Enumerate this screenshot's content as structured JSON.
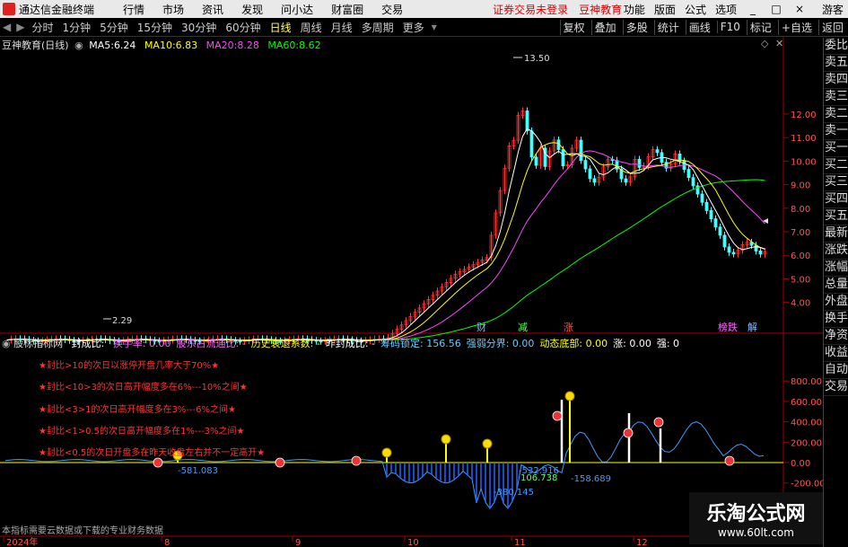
{
  "menubar": {
    "app_title": "通达信金融终端",
    "menus": [
      "行情",
      "市场",
      "资讯",
      "发现",
      "问小达",
      "财富圈",
      "交易"
    ],
    "notice": "证券交易未登录",
    "brand": "豆神教育",
    "right_items": [
      "功能",
      "版面",
      "公式",
      "选项"
    ],
    "guest": "游客",
    "window_buttons": [
      "_",
      "□",
      "×"
    ]
  },
  "period_bar": {
    "periods": [
      "分时",
      "1分钟",
      "5分钟",
      "15分钟",
      "30分钟",
      "60分钟",
      "日线",
      "周线",
      "月线",
      "多周期",
      "更多"
    ],
    "active": "日线",
    "tools": [
      "复权",
      "叠加",
      "多股",
      "统计",
      "画线",
      "F10",
      "标记",
      "+自选",
      "返回"
    ]
  },
  "main_chart": {
    "title": "豆神教育(日线)",
    "ma": [
      {
        "label": "MA5:",
        "value": "6.24",
        "color": "#ffffff"
      },
      {
        "label": "MA10:",
        "value": "6.83",
        "color": "#ffff00"
      },
      {
        "label": "MA20:",
        "value": "8.28",
        "color": "#ff44ff"
      },
      {
        "label": "MA60:",
        "value": "8.62",
        "color": "#00ff00"
      }
    ],
    "y_ticks": [
      "12.00",
      "11.00",
      "10.00",
      "9.00",
      "8.00",
      "7.00",
      "6.00",
      "5.00",
      "4.00"
    ],
    "high_label": "13.50",
    "low_label": "2.29",
    "markers": [
      {
        "text": "财",
        "color": "#88bbff"
      },
      {
        "text": "减",
        "color": "#66ff66"
      },
      {
        "text": "涨",
        "color": "#ff5555"
      },
      {
        "text": "榜跌",
        "color": "#ff66ff"
      },
      {
        "text": "解",
        "color": "#88bbff"
      }
    ]
  },
  "indicator": {
    "name": "股标指标网",
    "items": [
      {
        "label": "封成比:",
        "value": "",
        "color": "#ffffff"
      },
      {
        "label": "换手率:",
        "value": "0.00",
        "color": "#ff66ff"
      },
      {
        "label": "股东占流通比:",
        "value": "-",
        "color": "#ff66ff"
      },
      {
        "label": "历史衰退系数:",
        "value": "-",
        "color": "#ffff00"
      },
      {
        "label": "昨封成比:",
        "value": "-",
        "color": "#ffffff"
      },
      {
        "label": "筹码锁定:",
        "value": "156.56",
        "color": "#66ccff"
      },
      {
        "label": "强弱分界:",
        "value": "0.00",
        "color": "#66ccff"
      },
      {
        "label": "动态底部:",
        "value": "0.00",
        "color": "#ffff00"
      },
      {
        "label": "涨:",
        "value": "0.00",
        "color": "#ffffff"
      },
      {
        "label": "强:",
        "value": "0",
        "color": "#ffffff"
      }
    ],
    "notes": [
      "★封比>10的次日以涨停开盘几率大于70%★",
      "★封比<10>3的次日高开幅度多在6%---10%之间★",
      "★封比<3>1的次日高开幅度多在3%---6%之间★",
      "★封比<1>0.5的次日高开幅度多在1%---3%之间★",
      "★封比<0.5的次日开盘多在昨天收盘左右并不一定高开★"
    ],
    "y_ticks": [
      "800.00",
      "600.00",
      "400.00",
      "200.00",
      "0.00",
      "-200.00"
    ],
    "value_labels": [
      "-581.083",
      "-532.916",
      "-158.689",
      "106.738",
      "-380.145"
    ]
  },
  "footer": {
    "note": "本指标需要云数据或下载的专业财务数据",
    "x_labels": [
      "2024年",
      "8",
      "9",
      "10",
      "11",
      "12"
    ],
    "watermark": "乐淘公式网",
    "watermark_url": "www.60lt.com"
  },
  "side_panel": [
    "委比",
    "卖五",
    "卖四",
    "卖三",
    "卖二",
    "卖一",
    "买一",
    "买二",
    "买三",
    "买四",
    "买五",
    "最新",
    "涨跌",
    "涨幅",
    "总量",
    "外盘",
    "换手",
    "净资",
    "收益",
    "自动",
    "交易"
  ],
  "colors": {
    "up": "#ff3333",
    "down": "#44ffff",
    "ma5": "#ffffff",
    "ma10": "#ffff00",
    "ma20": "#ff44ff",
    "ma60": "#00ff00"
  }
}
